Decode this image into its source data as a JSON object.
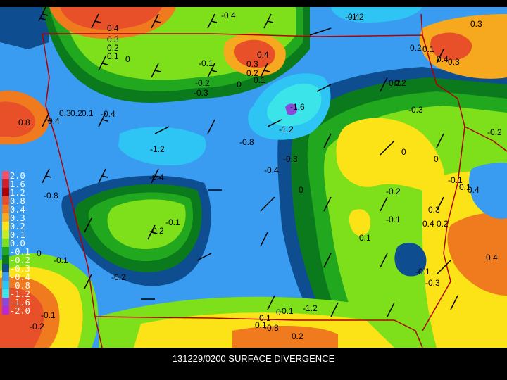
{
  "caption": "131229/0200 SURFACE DIVERGENCE",
  "legend": [
    {
      "label": "2.0",
      "color": "#f0506a"
    },
    {
      "label": "1.6",
      "color": "#d41e2a"
    },
    {
      "label": "1.2",
      "color": "#b00000"
    },
    {
      "label": "0.8",
      "color": "#e8502a"
    },
    {
      "label": "0.4",
      "color": "#f07a1e"
    },
    {
      "label": "0.3",
      "color": "#f6a81e"
    },
    {
      "label": "0.2",
      "color": "#fbe318"
    },
    {
      "label": "0.1",
      "color": "#c8ea20"
    },
    {
      "label": "0.0",
      "color": "#7ee01a"
    },
    {
      "label": "-0.1",
      "color": "#22a81e"
    },
    {
      "label": "-0.2",
      "color": "#0b7a1c"
    },
    {
      "label": "-0.3",
      "color": "#0e4e90"
    },
    {
      "label": "-0.4",
      "color": "#3a9cf0"
    },
    {
      "label": "-0.8",
      "color": "#2ec4f4"
    },
    {
      "label": "-1.2",
      "color": "#3ae4e8"
    },
    {
      "label": "-1.6",
      "color": "#8a4ad8"
    },
    {
      "label": "-2.0",
      "color": "#b42ad6"
    }
  ],
  "contour_labels": [
    "0.4",
    "0.3",
    "0.2",
    "0.1",
    "0",
    "0.4",
    "0.3",
    "0.2",
    "0.1",
    "0",
    "-0.1",
    "-0.2",
    "-0.3",
    "-0.4",
    "-1.2",
    "-1.6",
    "-1.2",
    "-0.8",
    "-0.3",
    "-0.4",
    "-1.2",
    "0.8",
    "0.4",
    "0.3",
    "0.2",
    "0.1",
    "-0.4",
    "-0.8",
    "-0.4",
    "-0.1",
    "0",
    "-0.2",
    "-0.1",
    "-0.2",
    "-0.1",
    "-0.8",
    "0.1",
    "0.2",
    "0.3",
    "0.4",
    "0.2",
    "0.1",
    "0",
    "-0.2",
    "-0.1",
    "-0.1",
    "-0.3",
    "-0.2",
    "0",
    "0.2",
    "0.1",
    "0.3",
    "0.4",
    "-0.1",
    "0",
    "0.1",
    "0.4",
    "0.3",
    "0.2",
    "-0.2",
    "-0.3",
    "-0.4",
    "-1.2",
    "0",
    "0.1",
    "-0.1",
    "-0.2",
    "0.4"
  ]
}
